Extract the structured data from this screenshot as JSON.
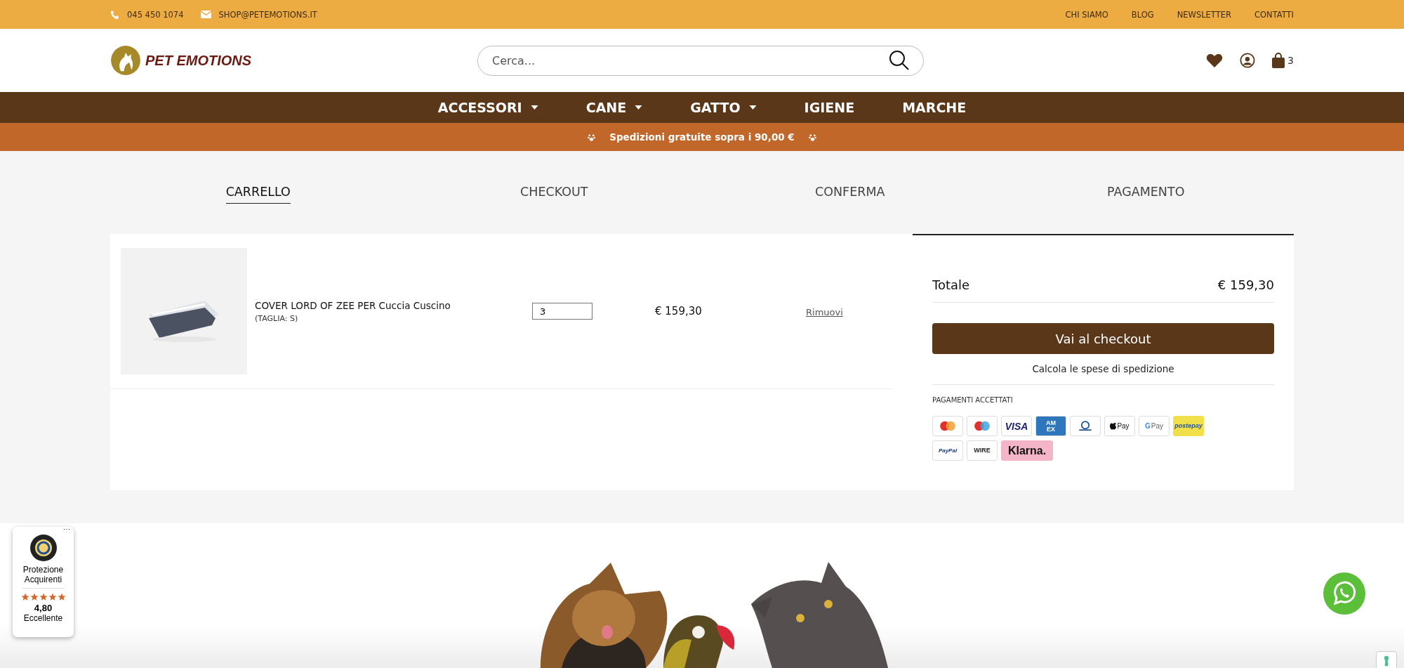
{
  "top_bar": {
    "phone": "045 450 1074",
    "email": "SHOP@PETEMOTIONS.IT",
    "links": [
      "CHI SIAMO",
      "BLOG",
      "NEWSLETTER",
      "CONTATTI"
    ]
  },
  "header": {
    "logo": "PET EMOTIONS",
    "search": {
      "placeholder": "Cerca..."
    },
    "cart_count": "3"
  },
  "nav": [
    {
      "label": "ACCESSORI",
      "has_menu": true
    },
    {
      "label": "CANE",
      "has_menu": true
    },
    {
      "label": "GATTO",
      "has_menu": true
    },
    {
      "label": "IGIENE",
      "has_menu": false
    },
    {
      "label": "MARCHE",
      "has_menu": false
    }
  ],
  "promo": "Spedizioni gratuite sopra i 90,00 €",
  "steps": [
    {
      "label": "CARRELLO",
      "selected": true
    },
    {
      "label": "CHECKOUT",
      "selected": false
    },
    {
      "label": "CONFERMA",
      "selected": false
    },
    {
      "label": "PAGAMENTO",
      "selected": false
    }
  ],
  "cart_items": [
    {
      "name": "COVER LORD OF ZEE PER Cuccia Cuscino",
      "variant": "(TAGLIA: S)",
      "quantity": "3",
      "price": "€ 159,30",
      "remove": "Rimuovi"
    }
  ],
  "summary": {
    "total_label": "Totale",
    "total": "€ 159,30",
    "checkout_button": "Vai al checkout",
    "shipping_link": "Calcola le spese di spedizione",
    "payments_title": "PAGAMENTI ACCETTATI",
    "payments": [
      {
        "kind": "mastercard"
      },
      {
        "kind": "maestro"
      },
      {
        "kind": "visa",
        "label": "VISA"
      },
      {
        "kind": "amex",
        "label": "AM EX"
      },
      {
        "kind": "diners"
      },
      {
        "kind": "applepay",
        "label": "Pay"
      },
      {
        "kind": "googlepay",
        "mark": "G",
        "label": "Pay"
      },
      {
        "kind": "postepay",
        "label": "postepay"
      },
      {
        "kind": "paypal",
        "label": "PayPal"
      },
      {
        "kind": "wire",
        "label": "WIRE"
      },
      {
        "kind": "klarna",
        "label": "Klarna."
      }
    ]
  },
  "trust_badge": {
    "menu": "···",
    "title": "Protezione Acquirenti",
    "stars": 5,
    "rating": "4,80",
    "verdict": "Eccellente"
  }
}
